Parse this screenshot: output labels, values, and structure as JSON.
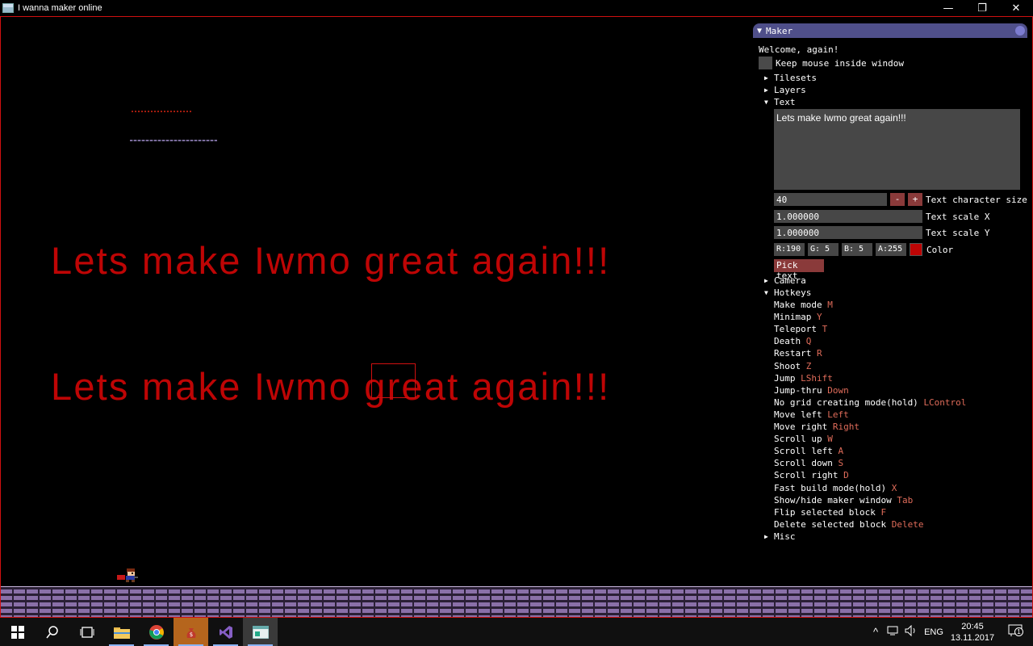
{
  "window": {
    "title": "I wanna maker online",
    "minimize": "—",
    "maximize": "❐",
    "close": "✕"
  },
  "game": {
    "big_text": "Lets make Iwmo great again!!!"
  },
  "maker": {
    "header": "Maker",
    "welcome": "Welcome, again!",
    "keep_mouse_label": "Keep mouse inside window",
    "tree": {
      "tilesets": "Tilesets",
      "layers": "Layers",
      "text": "Text",
      "camera": "Camera",
      "hotkeys": "Hotkeys",
      "misc": "Misc"
    },
    "text_section": {
      "content": "Lets make Iwmo great again!!!",
      "char_size_value": "40",
      "char_size_label": "Text character size",
      "minus": "-",
      "plus": "+",
      "scale_x_value": "1.000000",
      "scale_x_label": "Text scale X",
      "scale_y_value": "1.000000",
      "scale_y_label": "Text scale Y",
      "r": "R:190",
      "g": "G:  5",
      "b": "B:  5",
      "a": "A:255",
      "color_label": "Color",
      "color_hex": "#be0505",
      "pick_text": "Pick text"
    },
    "hotkeys": [
      {
        "action": "Make mode",
        "key": "M"
      },
      {
        "action": "Minimap",
        "key": "Y"
      },
      {
        "action": "Teleport",
        "key": "T"
      },
      {
        "action": "Death",
        "key": "Q"
      },
      {
        "action": "Restart",
        "key": "R"
      },
      {
        "action": "Shoot",
        "key": "Z"
      },
      {
        "action": "Jump",
        "key": "LShift"
      },
      {
        "action": "Jump-thru",
        "key": "Down"
      },
      {
        "action": "No grid creating mode(hold)",
        "key": "LControl"
      },
      {
        "action": "Move left",
        "key": "Left"
      },
      {
        "action": "Move right",
        "key": "Right"
      },
      {
        "action": "Scroll up",
        "key": "W"
      },
      {
        "action": "Scroll left",
        "key": "A"
      },
      {
        "action": "Scroll down",
        "key": "S"
      },
      {
        "action": "Scroll right",
        "key": "D"
      },
      {
        "action": "Fast build mode(hold)",
        "key": "X"
      },
      {
        "action": "Show/hide maker window",
        "key": "Tab"
      },
      {
        "action": "Flip selected block",
        "key": "F"
      },
      {
        "action": "Delete selected block",
        "key": "Delete"
      }
    ]
  },
  "taskbar": {
    "lang": "ENG",
    "time": "20:45",
    "date": "13.11.2017",
    "notif_count": "1"
  }
}
